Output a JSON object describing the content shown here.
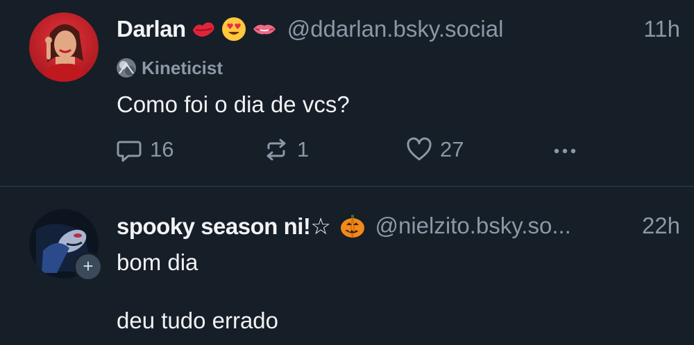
{
  "posts": [
    {
      "display_name": "Darlan",
      "emojis": [
        "lips-emoji",
        "heart-eyes-emoji",
        "mouth-emoji"
      ],
      "handle": "@ddarlan.bsky.social",
      "time": "11h",
      "label": "Kineticist",
      "text": "Como foi o dia de vcs?",
      "counts": {
        "replies": "16",
        "reposts": "1",
        "likes": "27"
      }
    },
    {
      "display_name": "spooky season ni!☆",
      "emojis": [
        "jack-o-lantern-emoji"
      ],
      "handle": "@nielzito.bsky.so...",
      "time": "22h",
      "text": "bom dia\n\ndeu tudo errado",
      "follow_badge": "+"
    }
  ],
  "colors": {
    "background": "#161e27",
    "text_primary": "#f1f3f5",
    "text_secondary": "#8b98a6",
    "divider": "#26313d"
  }
}
